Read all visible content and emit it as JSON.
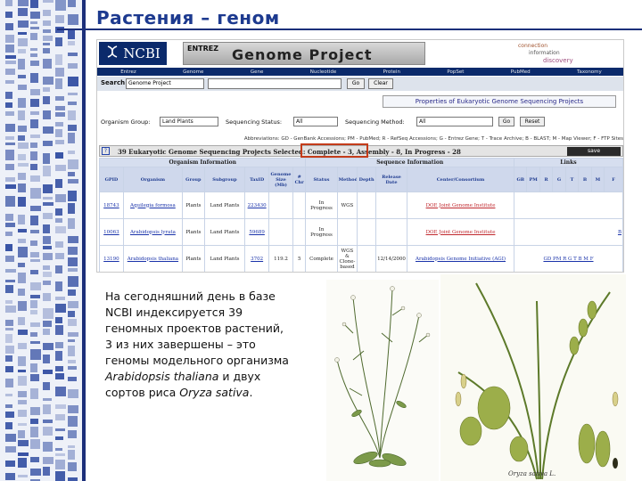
{
  "slide": {
    "title": "Растения – геном",
    "description_lines": [
      "На сегодняшний день в базе",
      "NCBI индексируется 39",
      "геномных проектов растений,",
      "3 из них завершены – это",
      "геномы модельного организма"
    ],
    "description_species1": "Arabidopsis thaliana",
    "description_and": " и двух",
    "description_prefix_last": "сортов риса ",
    "description_species2": "Oryza sativa",
    "description_end": "."
  },
  "header": {
    "logo_text": "NCBI",
    "entrez_label": "ENTREZ",
    "product_title": "Genome Project",
    "tagline": [
      "connection",
      "information",
      "discovery"
    ]
  },
  "nav": {
    "items": [
      "Entrez",
      "Genome",
      "Gene",
      "Nucleotide",
      "Protein",
      "PopSet",
      "PubMed",
      "Taxonomy"
    ]
  },
  "search": {
    "label": "Search",
    "db_value": "Genome Project",
    "query_value": "",
    "go_label": "Go",
    "clear_label": "Clear"
  },
  "panel": {
    "title": "Properties of Eukaryotic Genome Sequencing Projects"
  },
  "filters": {
    "group_label": "Organism Group:",
    "group_value": "Land Plants",
    "status_label": "Sequencing Status:",
    "status_value": "All",
    "method_label": "Sequencing Method:",
    "method_value": "All",
    "go_label": "Go",
    "reset_label": "Reset"
  },
  "abbreviations": "Abbreviations: GD - GenBank Accessions; PM - PubMed; R - RefSeq Accessions; G - Entrez Gene; T - Trace Archive; B - BLAST; M - Map Viewer; F - FTP Sites",
  "summary": {
    "help_label": "?",
    "text": "39 Eukaryotic Genome Sequencing Projects Selected: Complete - 3, Assembly - 8, In Progress - 28",
    "save_label": "save"
  },
  "table": {
    "group_headers": {
      "organism": "Organism Information",
      "sequence": "Sequence Information",
      "links": "Links"
    },
    "columns": [
      "GPID",
      "Organism",
      "Group",
      "Subgroup",
      "TaxID",
      "Genome Size (Mb)",
      "# Chr",
      "Status",
      "Method",
      "Depth",
      "Release Date",
      "Center/Consortium",
      "GB",
      "PM",
      "R",
      "G",
      "T",
      "B",
      "M",
      "F"
    ],
    "rows": [
      {
        "gpid": "18743",
        "organism": "Aquilegia formosa",
        "group": "Plants",
        "subgroup": "Land Plants",
        "taxid": "223430",
        "size": "",
        "chr": "",
        "status": "In Progress",
        "method": "WGS",
        "depth": "",
        "date": "",
        "center": "DOE Joint Genome Institute",
        "links": ""
      },
      {
        "gpid": "10063",
        "organism": "Arabidopsis lyrata",
        "group": "Plants",
        "subgroup": "Land Plants",
        "taxid": "59689",
        "size": "",
        "chr": "",
        "status": "In Progress",
        "method": "",
        "depth": "",
        "date": "",
        "center": "DOE Joint Genome Institute",
        "links": "B"
      },
      {
        "gpid": "13190",
        "organism": "Arabidopsis thaliana",
        "group": "Plants",
        "subgroup": "Land Plants",
        "taxid": "3702",
        "size": "119.2",
        "chr": "5",
        "status": "Complete",
        "method": "WGS & Clone-based",
        "depth": "",
        "date": "12/14/2000",
        "center": "Arabidopsis Genome Initiative (AGI)",
        "links": "GD PM R G T B M F"
      }
    ]
  },
  "images": {
    "plant2_caption": "Oryza sativa L."
  },
  "colors": {
    "title": "#1d3a8f",
    "rule": "#1c2f7a",
    "highlight_box": "#c43c1a",
    "ncbi_navy": "#0b2a6b"
  }
}
